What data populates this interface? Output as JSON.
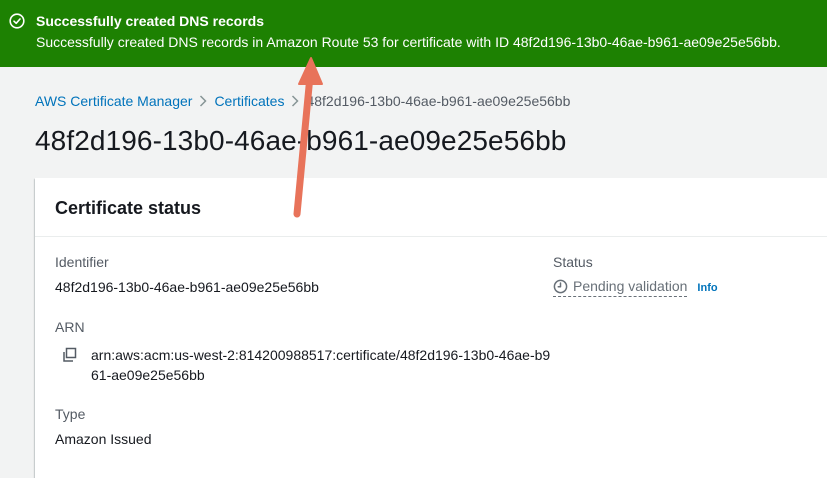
{
  "flash": {
    "icon": "success-check-icon",
    "title": "Successfully created DNS records",
    "message": "Successfully created DNS records in Amazon Route 53 for certificate with ID 48f2d196-13b0-46ae-b961-ae09e25e56bb.",
    "color": "#1d8102"
  },
  "breadcrumb": {
    "items": [
      "AWS Certificate Manager",
      "Certificates"
    ],
    "current": "48f2d196-13b0-46ae-b961-ae09e25e56bb"
  },
  "page": {
    "title": "48f2d196-13b0-46ae-b961-ae09e25e56bb"
  },
  "panel": {
    "title": "Certificate status",
    "identifier_label": "Identifier",
    "identifier_value": "48f2d196-13b0-46ae-b961-ae09e25e56bb",
    "status_label": "Status",
    "status_value": "Pending validation",
    "status_icon": "clock-icon",
    "info_label": "Info",
    "arn_label": "ARN",
    "arn_value": "arn:aws:acm:us-west-2:814200988517:certificate/48f2d196-13b0-46ae-b961-ae09e25e56bb",
    "type_label": "Type",
    "type_value": "Amazon Issued"
  },
  "colors": {
    "link": "#0073bb",
    "annotation_arrow": "#e8735a"
  }
}
